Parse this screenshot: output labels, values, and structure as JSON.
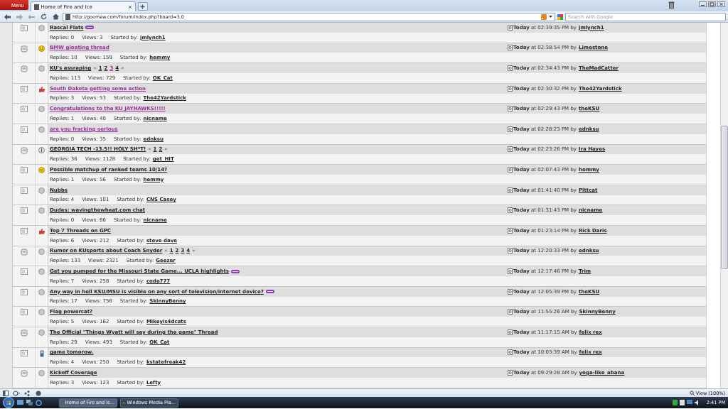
{
  "browser": {
    "menu": "Menu",
    "tab": {
      "title": "Home of Fire and Ice",
      "selected": true
    },
    "url": "http://goemaw.com/forum/index.php?board=3.0",
    "search": {
      "placeholder": "Search with Google"
    }
  },
  "topics": [
    {
      "topic_icon": {
        "kind": "normal"
      },
      "post_icon": {
        "kind": "xx"
      },
      "title": "Rascal Flats",
      "visited": false,
      "new": true,
      "replies": "Replies: 0",
      "views": "Views: 3",
      "started_label": "Started by:",
      "starter": "jmlynch1",
      "last": "**Today** at 02:39:35 PM by",
      "last_by": "jmlynch1"
    },
    {
      "topic_icon": {
        "kind": "hot"
      },
      "post_icon": {
        "kind": "smiley"
      },
      "title": "BMW gloating thread",
      "visited": true,
      "new": false,
      "replies": "Replies: 10",
      "views": "Views: 159",
      "started_label": "Started by:",
      "starter": "hemmy",
      "last": "**Today** at 02:38:54 PM by",
      "last_by": "Limestone"
    },
    {
      "topic_icon": {
        "kind": "hot"
      },
      "post_icon": {
        "kind": "xx"
      },
      "title": "KU's assraping",
      "visited": false,
      "new": false,
      "pager": {
        "prev": "«",
        "pages": [
          {
            "label": "1",
            "visited": false
          },
          {
            "label": "2",
            "visited": false
          },
          {
            "label": "3",
            "visited": true
          },
          {
            "label": "4",
            "visited": false
          }
        ],
        "next": "»"
      },
      "replies": "Replies: 113",
      "views": "Views: 729",
      "started_label": "Started by:",
      "starter": "OK_Cat",
      "last": "**Today** at 02:34:43 PM by",
      "last_by": "TheMadCatter"
    },
    {
      "topic_icon": {
        "kind": "normal"
      },
      "post_icon": {
        "kind": "thumbup"
      },
      "title": "South Dakota getting some action",
      "visited": true,
      "new": false,
      "replies": "Replies: 3",
      "views": "Views: 53",
      "started_label": "Started by:",
      "starter": "The42Yardstick",
      "last": "**Today** at 02:30:32 PM by",
      "last_by": "The42Yardstick"
    },
    {
      "topic_icon": {
        "kind": "normal"
      },
      "post_icon": {
        "kind": "xx"
      },
      "title": "Congratulations to the KU JAYHAWKS!!!!!",
      "visited": true,
      "new": false,
      "replies": "Replies: 1",
      "views": "Views: 40",
      "started_label": "Started by:",
      "starter": "nicname",
      "last": "**Today** at 02:29:43 PM by",
      "last_by": "theKSU"
    },
    {
      "topic_icon": {
        "kind": "normal"
      },
      "post_icon": {
        "kind": "xx"
      },
      "title": "are you fracking serious",
      "visited": true,
      "new": false,
      "replies": "Replies: 0",
      "views": "Views: 35",
      "started_label": "Started by:",
      "starter": "ednksu",
      "last": "**Today** at 02:28:23 PM by",
      "last_by": "ednksu"
    },
    {
      "topic_icon": {
        "kind": "hot"
      },
      "post_icon": {
        "kind": "exclamation"
      },
      "title": "GEORGIA TECH -13.5!! HOLY SH*T!",
      "visited": false,
      "new": false,
      "pager": {
        "prev": "«",
        "pages": [
          {
            "label": "1",
            "visited": false
          },
          {
            "label": "2",
            "visited": false
          }
        ],
        "next": "»"
      },
      "replies": "Replies: 36",
      "views": "Views: 1128",
      "started_label": "Started by:",
      "starter": "get_HIT",
      "last": "**Today** at 02:23:26 PM by",
      "last_by": "Ira Hayes"
    },
    {
      "topic_icon": {
        "kind": "normal"
      },
      "post_icon": {
        "kind": "smiley"
      },
      "title": "Possible matchup of ranked teams 10/14?",
      "visited": false,
      "new": false,
      "replies": "Replies: 1",
      "views": "Views: 56",
      "started_label": "Started by:",
      "starter": "hemmy",
      "last": "**Today** at 02:07:43 PM by",
      "last_by": "hemmy"
    },
    {
      "topic_icon": {
        "kind": "normal"
      },
      "post_icon": {
        "kind": "xx"
      },
      "title": "Nubbs",
      "visited": false,
      "new": false,
      "replies": "Replies: 4",
      "views": "Views: 101",
      "started_label": "Started by:",
      "starter": "CNS Casey",
      "last": "**Today** at 01:41:40 PM by",
      "last_by": "Pittcat"
    },
    {
      "topic_icon": {
        "kind": "normal"
      },
      "post_icon": {
        "kind": "xx"
      },
      "title": "Dudes: wavingthewheat.com chat",
      "visited": false,
      "new": false,
      "replies": "Replies: 0",
      "views": "Views: 66",
      "started_label": "Started by:",
      "starter": "nicname",
      "last": "**Today** at 01:31:43 PM by",
      "last_by": "nicname"
    },
    {
      "topic_icon": {
        "kind": "normal"
      },
      "post_icon": {
        "kind": "thumbup"
      },
      "title": "Top 7 Threads on GPC",
      "visited": false,
      "new": false,
      "replies": "Replies: 6",
      "views": "Views: 212",
      "started_label": "Started by:",
      "starter": "steve dave",
      "last": "**Today** at 01:23:14 PM by",
      "last_by": "Rick Daris"
    },
    {
      "topic_icon": {
        "kind": "hot"
      },
      "post_icon": {
        "kind": "xx"
      },
      "title": "Rumor on KUsports about Coach Snyder",
      "visited": false,
      "new": false,
      "pager": {
        "prev": "«",
        "pages": [
          {
            "label": "1",
            "visited": false
          },
          {
            "label": "2",
            "visited": false
          },
          {
            "label": "3",
            "visited": false
          },
          {
            "label": "4",
            "visited": false
          }
        ],
        "next": "»"
      },
      "replies": "Replies: 133",
      "views": "Views: 2321",
      "started_label": "Started by:",
      "starter": "Geezer",
      "last": "**Today** at 12:20:33 PM by",
      "last_by": "ednksu"
    },
    {
      "topic_icon": {
        "kind": "normal"
      },
      "post_icon": {
        "kind": "xx"
      },
      "title": "Get you pumped for the Missouri State Game... UCLA highlights",
      "visited": false,
      "new": true,
      "replies": "Replies: 7",
      "views": "Views: 258",
      "started_label": "Started by:",
      "starter": "code777",
      "last": "**Today** at 12:17:46 PM by",
      "last_by": "Trim"
    },
    {
      "topic_icon": {
        "kind": "normal"
      },
      "post_icon": {
        "kind": "xx"
      },
      "title": "Any way in hell KSU/MSU is visible on any sort of television/internet device?",
      "visited": false,
      "new": true,
      "replies": "Replies: 17",
      "views": "Views: 756",
      "started_label": "Started by:",
      "starter": "SkinnyBenny",
      "last": "**Today** at 12:05:39 PM by",
      "last_by": "theKSU"
    },
    {
      "topic_icon": {
        "kind": "normal"
      },
      "post_icon": {
        "kind": "xx"
      },
      "title": "Flag powercat?",
      "visited": false,
      "new": false,
      "replies": "Replies: 5",
      "views": "Views: 162",
      "started_label": "Started by:",
      "starter": "Mikeyis4dcats",
      "last": "**Today** at 11:55:26 AM by",
      "last_by": "SkinnyBenny"
    },
    {
      "topic_icon": {
        "kind": "hot"
      },
      "post_icon": {
        "kind": "xx"
      },
      "title": "The Official \"Things Wyatt will say during the game\" Thread",
      "visited": false,
      "new": false,
      "replies": "Replies: 29",
      "views": "Views: 493",
      "started_label": "Started by:",
      "starter": "OK_Cat",
      "last": "**Today** at 11:17:15 AM by",
      "last_by": "felix rex"
    },
    {
      "topic_icon": {
        "kind": "normal"
      },
      "post_icon": {
        "kind": "clip"
      },
      "title": "game tomorow.",
      "visited": false,
      "new": false,
      "replies": "Replies: 4",
      "views": "Views: 250",
      "started_label": "Started by:",
      "starter": "kstatefreak42",
      "last": "**Today** at 10:03:39 AM by",
      "last_by": "felix rex"
    },
    {
      "topic_icon": {
        "kind": "hot"
      },
      "post_icon": {
        "kind": "xx"
      },
      "title": "Kickoff Coverage",
      "visited": false,
      "new": false,
      "replies": "Replies: 3",
      "views": "Views: 123",
      "started_label": "Started by:",
      "starter": "Lefty",
      "last": "**Today** at 09:29:28 AM by",
      "last_by": "yoga-like_abana"
    }
  ],
  "status_bar": {
    "zoom": "View (100%)"
  },
  "taskbar": {
    "tasks": [
      {
        "label": "Home of Fire and Ic...",
        "selected": true
      },
      {
        "label": "Windows Media Pla...",
        "selected": false
      }
    ],
    "clock": "2:41 PM"
  }
}
